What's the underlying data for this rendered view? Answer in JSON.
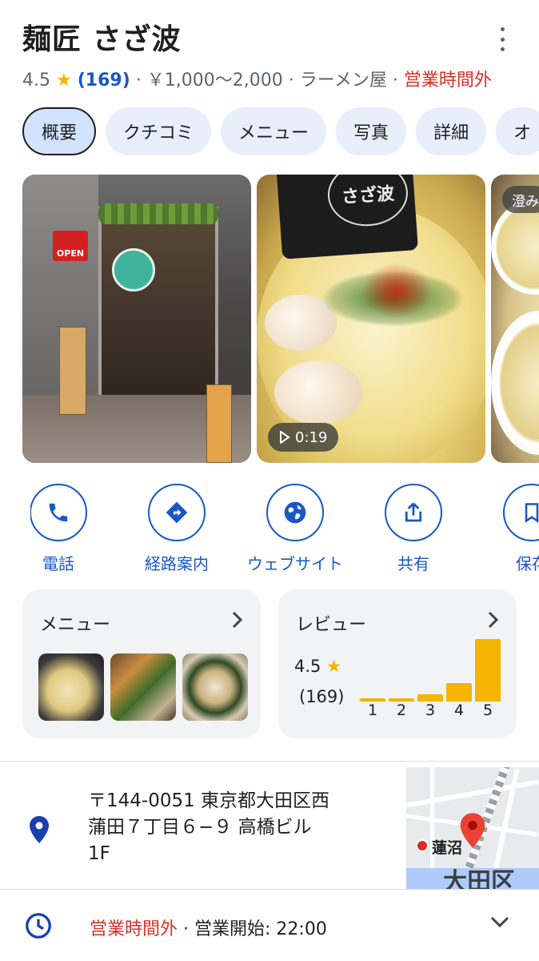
{
  "place": {
    "name": "麺匠 さざ波",
    "rating": "4.5",
    "rating_star": "★",
    "review_count": "(169)",
    "separator": "·",
    "price": "￥1,000～2,000",
    "category": "ラーメン屋",
    "status": "営業時間外"
  },
  "tabs": [
    "概要",
    "クチコミ",
    "メニュー",
    "写真",
    "詳細",
    "オ"
  ],
  "photos": {
    "video_duration": "0:19",
    "third_badge": "澄み",
    "shop_sign_open": "OPEN",
    "nori_logo": "さざ波"
  },
  "actions": [
    {
      "label": "電話",
      "icon": "phone-icon"
    },
    {
      "label": "経路案内",
      "icon": "directions-icon"
    },
    {
      "label": "ウェブサイト",
      "icon": "globe-icon"
    },
    {
      "label": "共有",
      "icon": "share-icon"
    },
    {
      "label": "保存",
      "icon": "bookmark-icon"
    }
  ],
  "menu_card": {
    "title": "メニュー",
    "chevron": "›"
  },
  "review_card": {
    "title": "レビュー",
    "chevron": "›",
    "score": "4.5",
    "star": "★",
    "count": "(169)",
    "bar_labels": [
      "1",
      "2",
      "3",
      "4",
      "5"
    ]
  },
  "chart_data": {
    "type": "bar",
    "categories": [
      "1",
      "2",
      "3",
      "4",
      "5"
    ],
    "values": [
      0.05,
      0.05,
      0.12,
      0.3,
      1.0
    ],
    "title": "",
    "xlabel": "",
    "ylabel": ""
  },
  "address": {
    "line1": "〒144-0051 東京都大田区西",
    "line2": "蒲田７丁目６−９ 高橋ビル",
    "line3": "1F"
  },
  "map": {
    "label_station": "蓮沼",
    "label_ward": "大田区"
  },
  "hours": {
    "status": "営業時間外",
    "separator": "·",
    "opens": "営業開始: 22:00"
  },
  "colors": {
    "accent_blue": "#1a56c6",
    "closed_red": "#d93025",
    "star_yellow": "#f4b400",
    "chip_bg": "#e8eefa"
  }
}
